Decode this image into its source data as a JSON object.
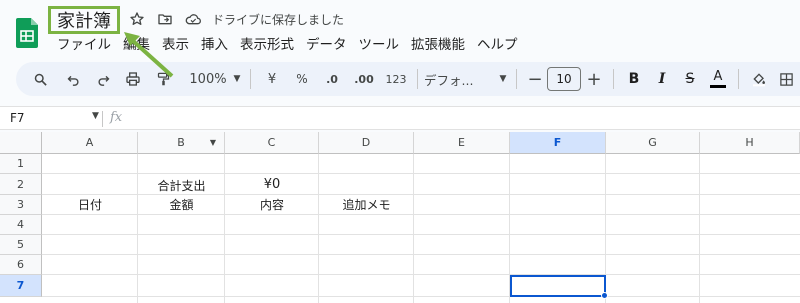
{
  "doc": {
    "title": "家計簿",
    "saved_status": "ドライブに保存しました"
  },
  "menu": [
    "ファイル",
    "編集",
    "表示",
    "挿入",
    "表示形式",
    "データ",
    "ツール",
    "拡張機能",
    "ヘルプ"
  ],
  "toolbar": {
    "zoom": "100%",
    "currency": "¥",
    "percent": "%",
    "decrease_decimal": ".0",
    "increase_decimal": ".00",
    "number_format": "123",
    "font": "デフォ...",
    "font_size": "10"
  },
  "formula_bar": {
    "cell_ref": "F7",
    "fx": "fx"
  },
  "columns": [
    "A",
    "B",
    "C",
    "D",
    "E",
    "F",
    "G",
    "H"
  ],
  "rows": [
    "1",
    "2",
    "3",
    "4",
    "5",
    "6",
    "7"
  ],
  "cells": {
    "B2": "合計支出",
    "C2": "¥0",
    "A3": "日付",
    "B3": "金額",
    "C3": "内容",
    "D3": "追加メモ"
  },
  "selected_cell": "F7",
  "colors": {
    "highlight_border": "#7cb342",
    "selection": "#0b57d0",
    "sheets_green": "#0f9d58"
  }
}
